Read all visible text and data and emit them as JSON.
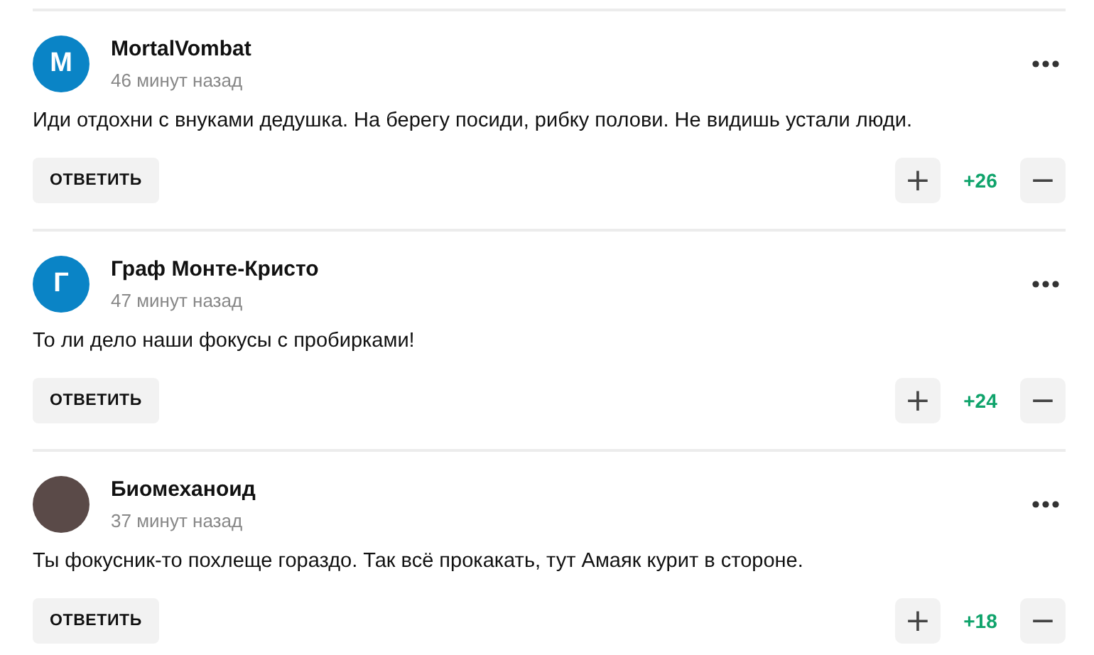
{
  "comments": [
    {
      "avatar": {
        "kind": "letter",
        "letter": "M"
      },
      "author": "MortalVombat",
      "time": "46 минут назад",
      "text": "Иди отдохни с внуками дедушка. На берегу посиди, рибку полови. Не видишь устали люди.",
      "reply": "ОТВЕТИТЬ",
      "plus": "+",
      "score": "+26",
      "minus": "−"
    },
    {
      "avatar": {
        "kind": "letter",
        "letter": "Г"
      },
      "author": "Граф Монте-Кристо",
      "time": "47 минут назад",
      "text": "То ли дело наши фокусы с пробирками!",
      "reply": "ОТВЕТИТЬ",
      "plus": "+",
      "score": "+24",
      "minus": "−"
    },
    {
      "avatar": {
        "kind": "photo"
      },
      "author": "Биомеханоид",
      "time": "37 минут назад",
      "text": "Ты фокусник-то похлеще гораздо. Так всё прокакать, тут Амаяк курит в стороне.",
      "reply": "ОТВЕТИТЬ",
      "plus": "+",
      "score": "+18",
      "minus": "−"
    }
  ]
}
